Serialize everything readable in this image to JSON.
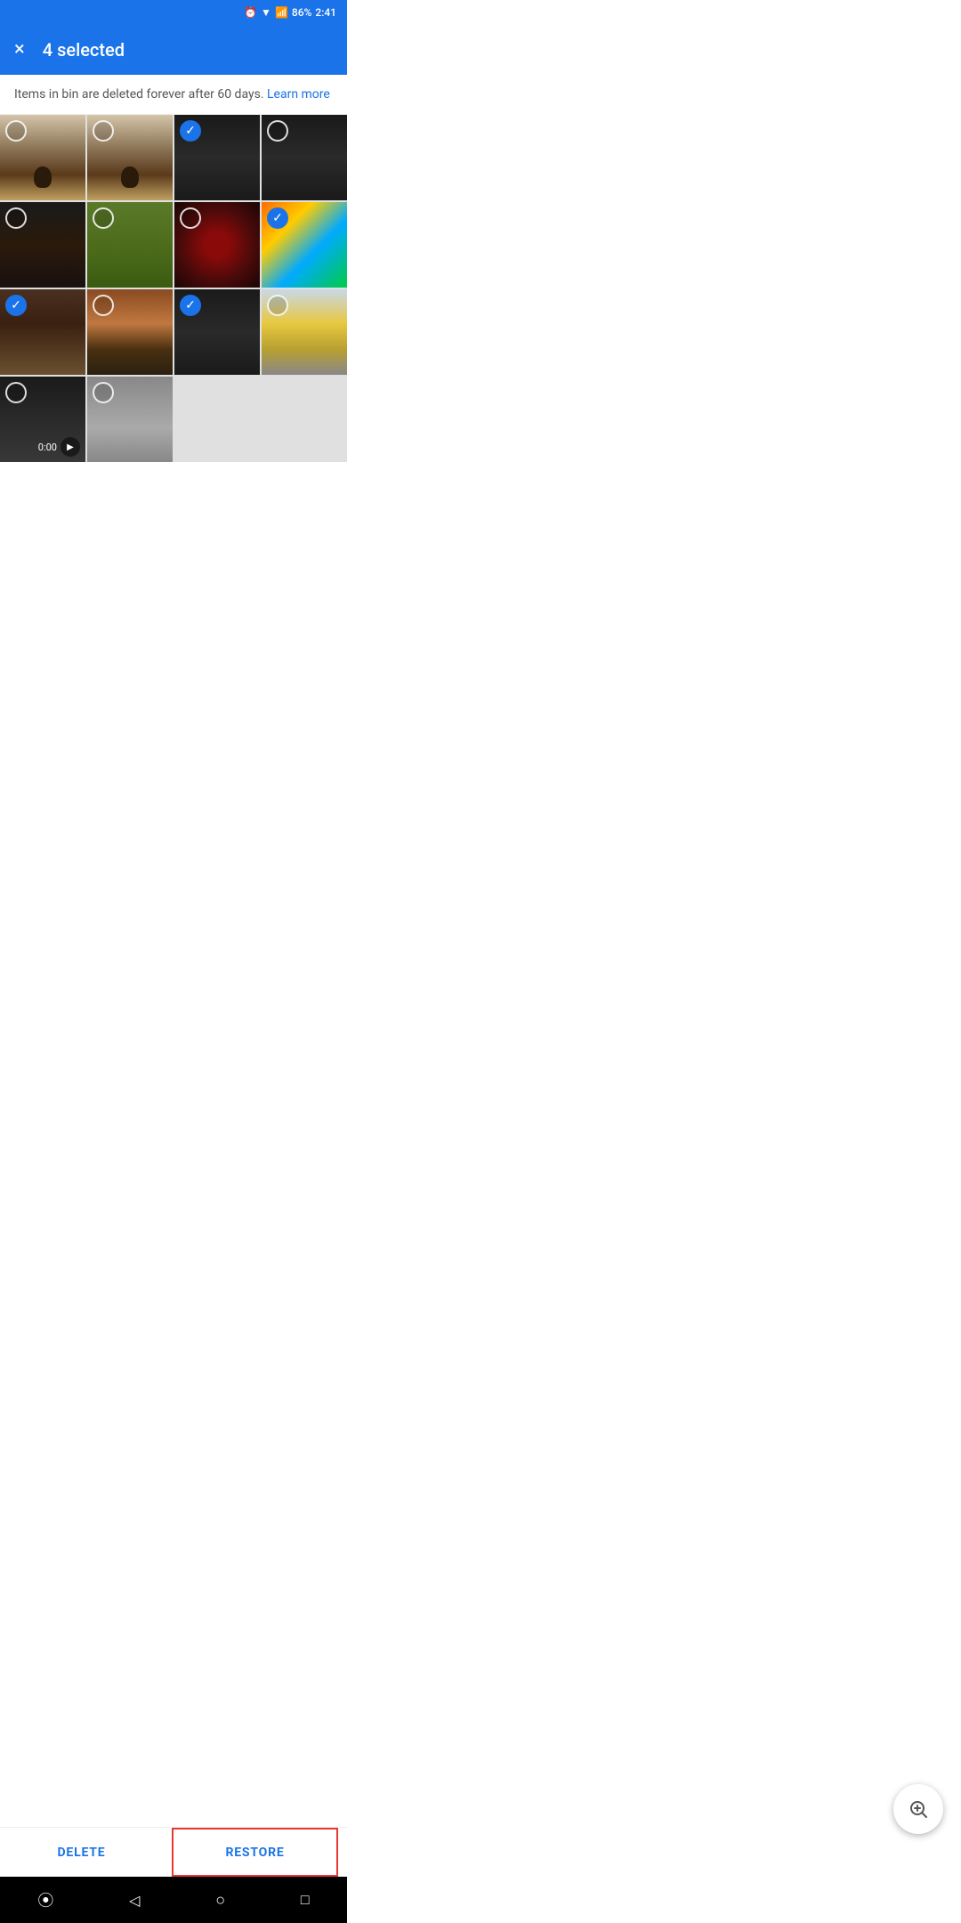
{
  "statusBar": {
    "battery": "86%",
    "time": "2:41",
    "icons": [
      "alarm",
      "wifi",
      "signal",
      "battery"
    ]
  },
  "appBar": {
    "closeLabel": "×",
    "title": "4 selected",
    "selectedCount": 4
  },
  "infoBanner": {
    "text": "Items in bin are deleted forever after 60 days.",
    "linkText": "Learn more"
  },
  "photos": [
    {
      "id": 1,
      "checked": false,
      "colorClass": "dog-gate",
      "row": 1,
      "col": 1
    },
    {
      "id": 2,
      "checked": false,
      "colorClass": "dog-gate",
      "row": 1,
      "col": 2
    },
    {
      "id": 3,
      "checked": true,
      "colorClass": "phone-screen",
      "row": 1,
      "col": 3
    },
    {
      "id": 4,
      "checked": false,
      "colorClass": "phone-screen",
      "row": 1,
      "col": 4
    },
    {
      "id": 5,
      "checked": false,
      "colorClass": "woman-dark",
      "row": 2,
      "col": 1
    },
    {
      "id": 6,
      "checked": false,
      "colorClass": "feet-grass",
      "row": 2,
      "col": 2
    },
    {
      "id": 7,
      "checked": false,
      "colorClass": "rain-red",
      "row": 2,
      "col": 3
    },
    {
      "id": 8,
      "checked": true,
      "colorClass": "colorful-face",
      "row": 2,
      "col": 4
    },
    {
      "id": 9,
      "checked": true,
      "colorClass": "food-plate",
      "row": 3,
      "col": 1
    },
    {
      "id": 10,
      "checked": false,
      "colorClass": "icecream",
      "row": 3,
      "col": 2
    },
    {
      "id": 11,
      "checked": true,
      "colorClass": "phone-screen",
      "row": 3,
      "col": 3
    },
    {
      "id": 12,
      "checked": false,
      "colorClass": "boy-yellow",
      "row": 3,
      "col": 4
    },
    {
      "id": 13,
      "checked": false,
      "colorClass": "laptop-video",
      "isVideo": true,
      "videoDuration": "0:00",
      "row": 4,
      "col": 1
    },
    {
      "id": 14,
      "checked": false,
      "colorClass": "keyboard",
      "row": 4,
      "col": 2
    }
  ],
  "fab": {
    "icon": "search-plus"
  },
  "bottomBar": {
    "deleteLabel": "DELETE",
    "restoreLabel": "RESTORE"
  },
  "navBar": {
    "icons": [
      "circle",
      "triangle",
      "circle-outline",
      "square"
    ]
  }
}
